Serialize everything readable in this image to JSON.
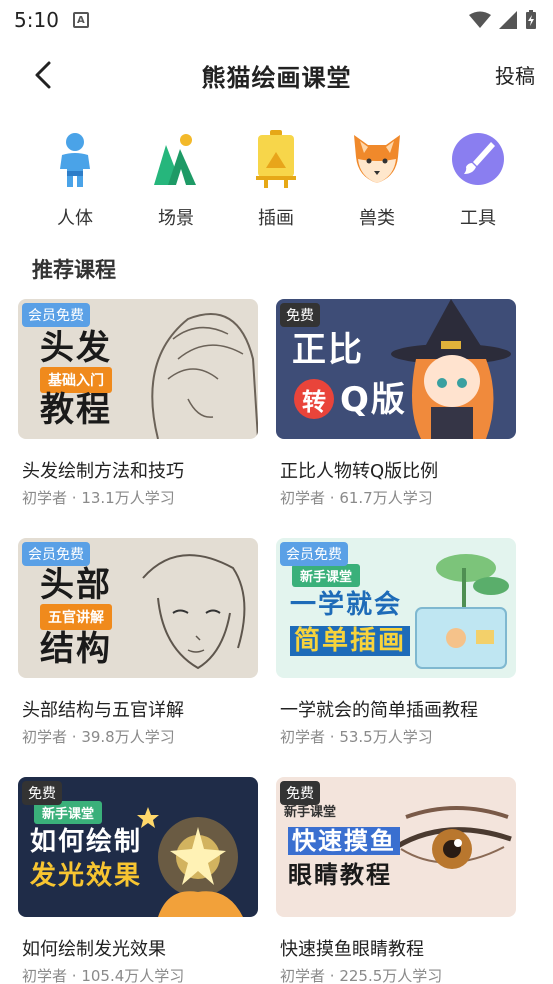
{
  "status": {
    "time": "5:10",
    "notif_letter": "A"
  },
  "header": {
    "title": "熊猫绘画课堂",
    "submit_label": "投稿"
  },
  "categories": [
    {
      "label": "人体",
      "icon": "human-figure-icon"
    },
    {
      "label": "场景",
      "icon": "mountain-scene-icon"
    },
    {
      "label": "插画",
      "icon": "easel-canvas-icon"
    },
    {
      "label": "兽类",
      "icon": "fox-head-icon"
    },
    {
      "label": "工具",
      "icon": "brush-tool-icon"
    }
  ],
  "section": {
    "title": "推荐课程"
  },
  "courses": [
    {
      "title": "头发绘制方法和技巧",
      "level": "初学者",
      "learners": "13.1万人学习",
      "badge": "会员免费",
      "thumb_line1": "头发",
      "thumb_tag": "基础入门",
      "thumb_line2": "教程"
    },
    {
      "title": "正比人物转Q版比例",
      "level": "初学者",
      "learners": "61.7万人学习",
      "badge": "免费",
      "thumb_line1": "正比",
      "thumb_tag": "转",
      "thumb_line2": "Q版"
    },
    {
      "title": "头部结构与五官详解",
      "level": "初学者",
      "learners": "39.8万人学习",
      "badge": "会员免费",
      "thumb_line1": "头部",
      "thumb_tag": "五官讲解",
      "thumb_line2": "结构"
    },
    {
      "title": "一学就会的简单插画教程",
      "level": "初学者",
      "learners": "53.5万人学习",
      "badge": "会员免费",
      "thumb_tag": "新手课堂",
      "thumb_line1": "一学就会",
      "thumb_line2": "简单插画"
    },
    {
      "title": "如何绘制发光效果",
      "level": "初学者",
      "learners": "105.4万人学习",
      "badge": "免费",
      "thumb_tag": "新手课堂",
      "thumb_line1": "如何绘制",
      "thumb_line2": "发光效果"
    },
    {
      "title": "快速摸鱼眼睛教程",
      "level": "初学者",
      "learners": "225.5万人学习",
      "badge": "免费",
      "thumb_tag": "新手课堂",
      "thumb_line1": "快速摸鱼",
      "thumb_line2": "眼睛教程"
    }
  ],
  "separator": " · "
}
